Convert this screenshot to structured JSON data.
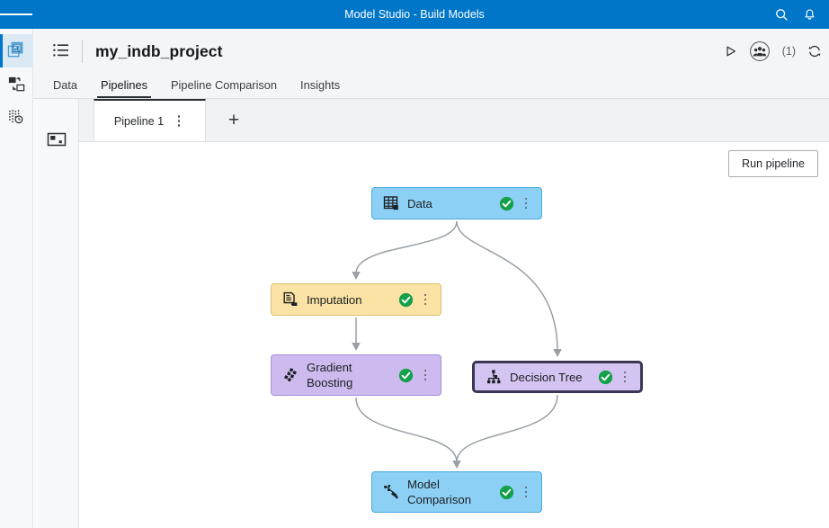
{
  "app_bar": {
    "title": "Model Studio - Build Models",
    "menu_icon": "hamburger-icon",
    "search_icon": "search-icon",
    "notifications_icon": "bell-icon",
    "background": "#0076c8"
  },
  "rail": {
    "items": [
      {
        "name": "sidebar-item-pipelines",
        "icon": "stacked-windows-icon",
        "active": true
      },
      {
        "name": "sidebar-item-data-exchange",
        "icon": "data-exchange-icon",
        "active": false
      },
      {
        "name": "sidebar-item-variables",
        "icon": "variables-clock-icon",
        "active": false
      }
    ]
  },
  "panel2": {
    "icon": "node-template-panel-icon"
  },
  "project_header": {
    "list_icon": "list-icon",
    "title": "my_indb_project",
    "run_icon": "play-icon",
    "collaborators_icon": "collaborators-icon",
    "collaborators_count": "(1)",
    "refresh_icon": "sync-icon"
  },
  "nav_tabs": {
    "items": [
      {
        "label": "Data",
        "active": false
      },
      {
        "label": "Pipelines",
        "active": true
      },
      {
        "label": "Pipeline Comparison",
        "active": false
      },
      {
        "label": "Insights",
        "active": false
      }
    ]
  },
  "pipeline_tabs": {
    "active_tab_label": "Pipeline 1",
    "kebab_icon": "more-options-icon",
    "add_label": "+"
  },
  "canvas": {
    "run_button_label": "Run pipeline",
    "status_icon": "check-circle-icon",
    "kebab_icon": "more-options-icon",
    "nodes": [
      {
        "id": "data",
        "label": "Data",
        "icon": "table-data-icon",
        "status": "success",
        "selected": false,
        "fill": "#8dd0f5",
        "border": "#4aa9e0"
      },
      {
        "id": "imputation",
        "label": "Imputation",
        "icon": "imputation-document-icon",
        "status": "success",
        "selected": false,
        "fill": "#fae3a4",
        "border": "#dfc06b"
      },
      {
        "id": "gradient_boosting",
        "label": "Gradient\nBoosting",
        "icon": "gradient-boosting-icon",
        "status": "success",
        "selected": false,
        "fill": "#cdbbef",
        "border": "#a98ede"
      },
      {
        "id": "decision_tree",
        "label": "Decision Tree",
        "icon": "decision-tree-icon",
        "status": "success",
        "selected": true,
        "fill": "#d4c4f2",
        "border": "#3c3654"
      },
      {
        "id": "model_comparison",
        "label": "Model\nComparison",
        "icon": "model-comparison-icon",
        "status": "success",
        "selected": false,
        "fill": "#8dd0f5",
        "border": "#4aa9e0"
      }
    ],
    "edges": [
      {
        "from": "data",
        "to": "imputation"
      },
      {
        "from": "data",
        "to": "decision_tree"
      },
      {
        "from": "imputation",
        "to": "gradient_boosting"
      },
      {
        "from": "gradient_boosting",
        "to": "model_comparison"
      },
      {
        "from": "decision_tree",
        "to": "model_comparison"
      }
    ],
    "edge_color": "#9aa0a6",
    "success_color": "#13a04a"
  }
}
